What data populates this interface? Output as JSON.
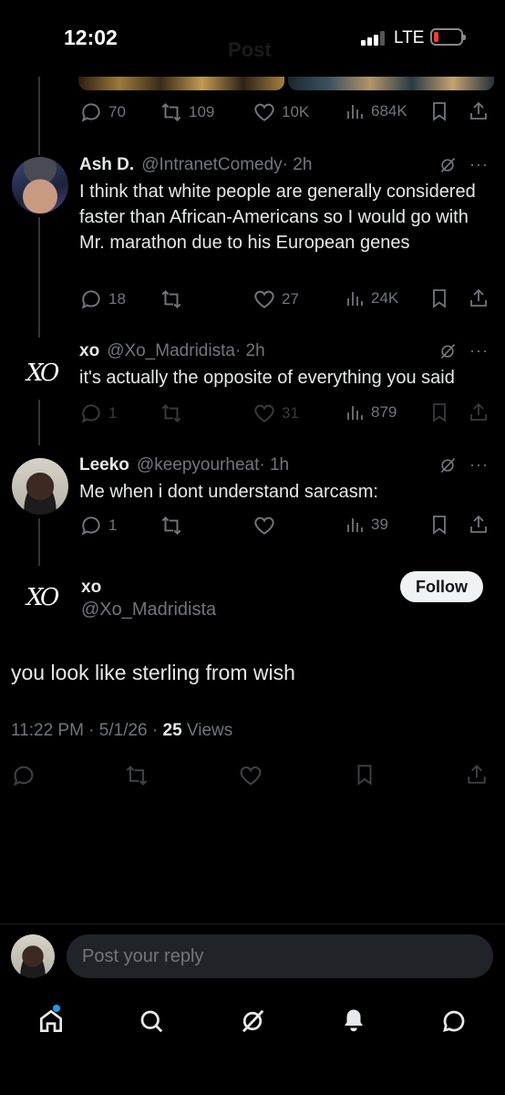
{
  "status_bar": {
    "time": "12:02",
    "network": "LTE",
    "header_title": "Post"
  },
  "top_tweet_actions": {
    "replies": "70",
    "reposts": "109",
    "likes": "10K",
    "views": "684K"
  },
  "replies": [
    {
      "name": "Ash D.",
      "handle": "@IntranetComedy",
      "time": "· 2h",
      "text": "I think that white people are generally considered faster than African-Americans so I would go with Mr. marathon due to his European genes",
      "replies": "18",
      "reposts": "",
      "likes": "27",
      "views": "24K"
    },
    {
      "name": "xo",
      "handle": "@Xo_Madridista",
      "time": "· 2h",
      "text": "it's actually the opposite of everything you said",
      "replies": "1",
      "reposts": "",
      "likes": "31",
      "views": "879"
    },
    {
      "name": "Leeko",
      "handle": "@keepyourheat",
      "time": "· 1h",
      "text": "Me when i dont understand sarcasm:",
      "replies": "1",
      "reposts": "",
      "likes": "",
      "views": "39"
    }
  ],
  "main_post": {
    "logo_text": "XO",
    "name": "xo",
    "handle": "@Xo_Madridista",
    "follow_label": "Follow",
    "text": "you look like sterling from wish",
    "timestamp": "11:22 PM · 5/1/26 · ",
    "views_count": "25",
    "views_label": " Views"
  },
  "reply_bar": {
    "placeholder": "Post your reply"
  },
  "nav": [
    "home-icon",
    "search-icon",
    "grok-icon",
    "notifications-icon",
    "messages-icon"
  ],
  "colors": {
    "background": "#000000",
    "text": "#e7e9ea",
    "muted": "#71767b",
    "accent": "#1d9bf0"
  }
}
